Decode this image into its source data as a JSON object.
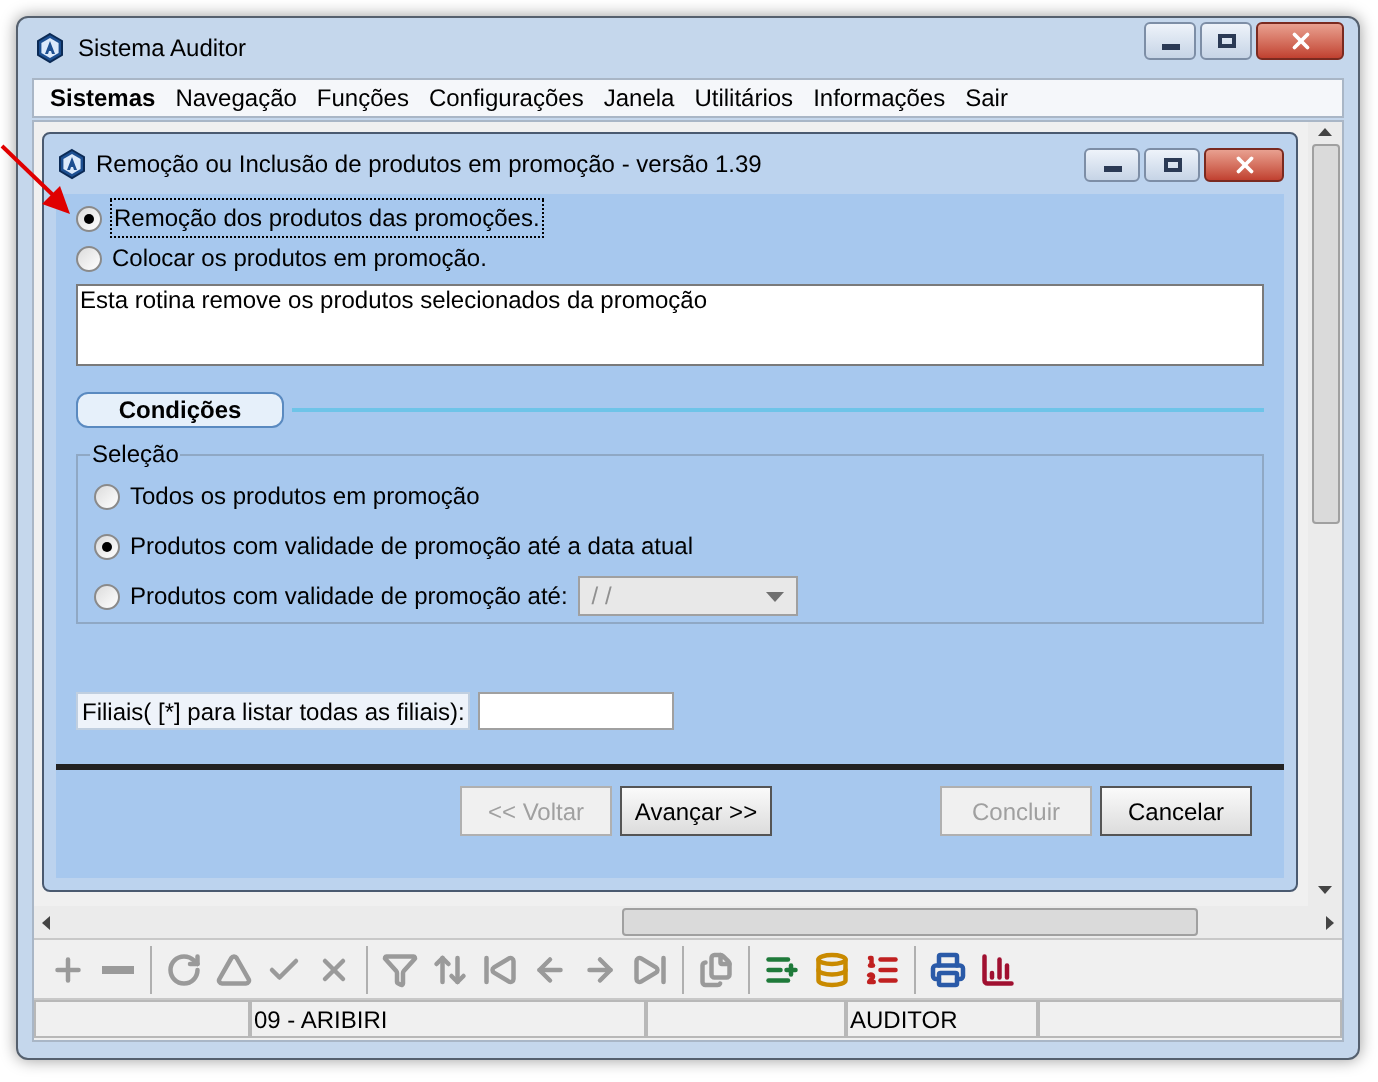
{
  "window": {
    "title": "Sistema Auditor"
  },
  "menu": [
    {
      "label": "Sistemas",
      "selected": true
    },
    {
      "label": "Navegação",
      "selected": false
    },
    {
      "label": "Funções",
      "selected": false
    },
    {
      "label": "Configurações",
      "selected": false
    },
    {
      "label": "Janela",
      "selected": false
    },
    {
      "label": "Utilitários",
      "selected": false
    },
    {
      "label": "Informações",
      "selected": false
    },
    {
      "label": "Sair",
      "selected": false
    }
  ],
  "dialog": {
    "title": "Remoção ou Inclusão de produtos em promoção - versão 1.39",
    "modes": [
      {
        "label": "Remoção dos produtos das promoções.",
        "selected": true
      },
      {
        "label": "Colocar os produtos em promoção.",
        "selected": false
      }
    ],
    "description": "Esta rotina remove os produtos selecionados da promoção",
    "section": "Condições",
    "group": "Seleção",
    "options": [
      {
        "label": "Todos os produtos em promoção",
        "selected": false
      },
      {
        "label": "Produtos com validade de promoção até a data atual",
        "selected": true
      },
      {
        "label": "Produtos com validade de promoção até:",
        "selected": false
      }
    ],
    "date": {
      "value": "/ /",
      "disabled": true
    },
    "filiais_label": "Filiais( [*] para listar todas as filiais):",
    "buttons": [
      {
        "label": "<< Voltar",
        "disabled": true
      },
      {
        "label": "Avançar >>",
        "disabled": false
      },
      {
        "label": "Concluir",
        "disabled": true
      },
      {
        "label": "Cancelar",
        "disabled": false
      }
    ]
  },
  "toolbar": [
    {
      "disabled": true
    },
    {
      "disabled": true
    },
    {
      "disabled": true
    },
    {
      "disabled": true
    },
    {
      "disabled": true
    },
    {
      "disabled": true
    },
    {
      "disabled": true
    },
    {
      "disabled": true
    },
    {
      "disabled": true
    },
    {
      "disabled": true
    },
    {
      "disabled": true
    },
    {
      "disabled": true
    },
    {
      "disabled": true
    },
    {
      "disabled": false
    },
    {
      "disabled": false
    },
    {
      "disabled": false
    },
    {
      "disabled": false
    },
    {
      "disabled": false
    }
  ],
  "status_bar": [
    "09 - ARIBIRI",
    "AUDITOR"
  ]
}
